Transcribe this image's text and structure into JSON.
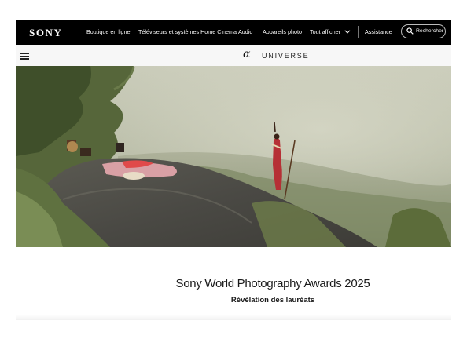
{
  "header": {
    "logo": "SONY",
    "nav": [
      "Boutique en ligne",
      "Téléviseurs et systèmes Home Cinema",
      "Audio",
      "Appareils photo",
      "Tout afficher",
      "Assistance"
    ],
    "search_label": "Rechercher"
  },
  "subnav": {
    "brand_symbol": "α",
    "brand_name": "UNIVERSE"
  },
  "hero": {
    "title": "Sony World Photography Awards 2025",
    "subtitle": "Révélation des lauréats"
  },
  "colors": {
    "topbar": "#000000",
    "subbar": "#f7f7f7",
    "text": "#1a1a1a"
  },
  "icons": [
    "search-icon",
    "chevron-down-icon",
    "menu-icon"
  ]
}
